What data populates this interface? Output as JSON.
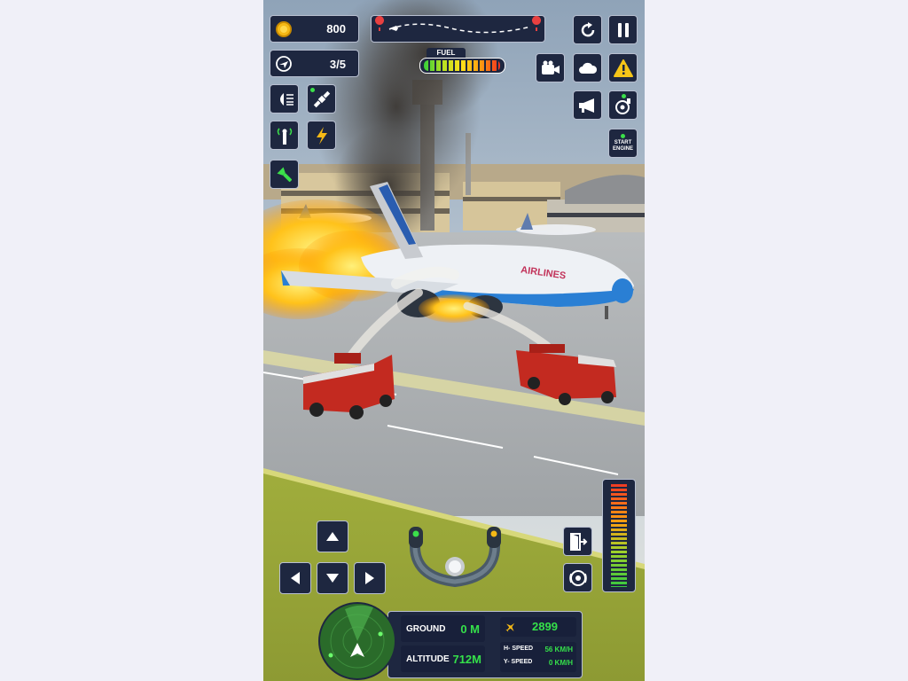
{
  "hud": {
    "coins": "800",
    "missions": "3/5",
    "fuel_label": "FUEL",
    "start_engine_line1": "START",
    "start_engine_line2": "ENGINE",
    "ground_label": "GROUND",
    "ground_value": "0 M",
    "altitude_label": "ALTITUDE",
    "altitude_value": "712M",
    "score": "2899",
    "h_speed_label": "H- SPEED",
    "h_speed_value": "56 KM/H",
    "y_speed_label": "Y- SPEED",
    "y_speed_value": "0 KM/H"
  },
  "scene": {
    "plane_livery_text": "AIRLINES"
  },
  "icons": [
    "coin-icon",
    "route-icon",
    "restart-icon",
    "pause-icon",
    "mission-icon",
    "camera-icon",
    "weather-icon",
    "warning-icon",
    "headlight-icon",
    "satellite-icon",
    "megaphone-icon",
    "engine-fan-icon",
    "tower-icon",
    "lightning-icon",
    "flashlight-icon",
    "exit-door-icon",
    "brake-icon",
    "yoke-icon",
    "radar-icon",
    "arrow-up-icon",
    "arrow-left-icon",
    "arrow-down-icon",
    "arrow-right-icon",
    "plane-icon"
  ],
  "colors": {
    "panel": "#1e2740",
    "accent_green": "#35e04a",
    "panel_border": "#b8bfd0"
  }
}
